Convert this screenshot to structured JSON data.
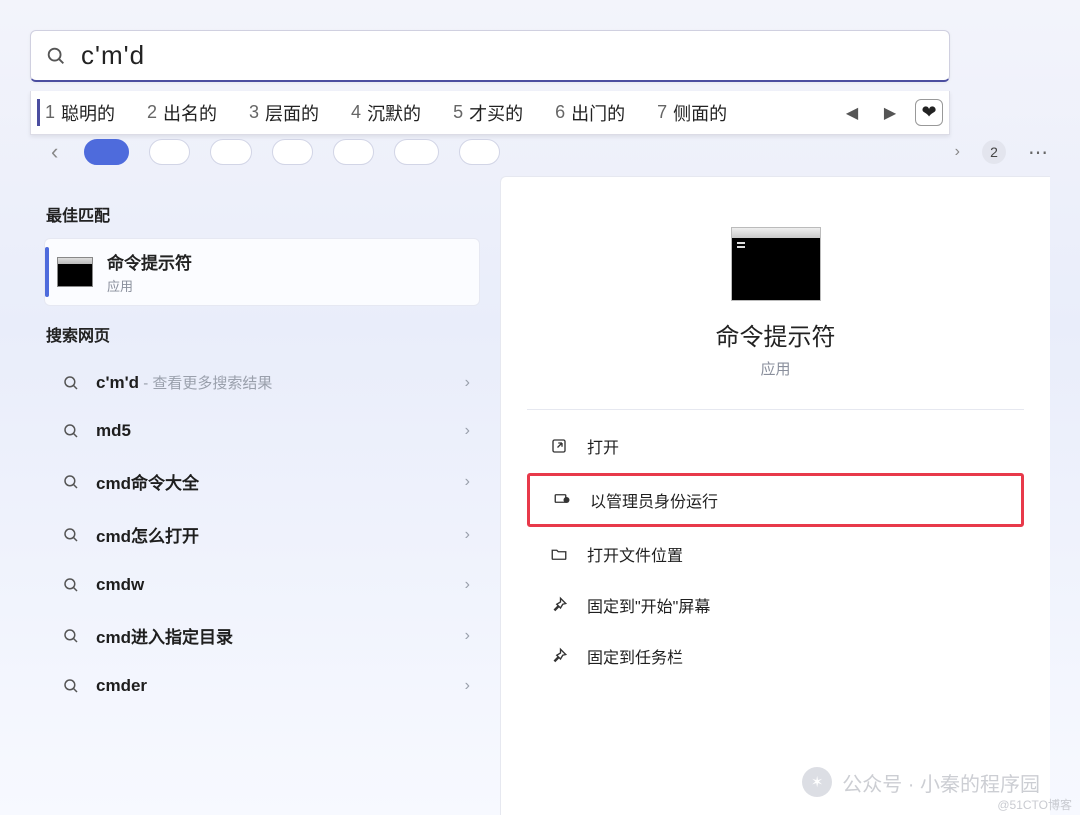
{
  "search": {
    "value": "c'm'd"
  },
  "ime": {
    "candidates": [
      {
        "n": "1",
        "w": "聪明的"
      },
      {
        "n": "2",
        "w": "出名的"
      },
      {
        "n": "3",
        "w": "层面的"
      },
      {
        "n": "4",
        "w": "沉默的"
      },
      {
        "n": "5",
        "w": "才买的"
      },
      {
        "n": "6",
        "w": "出门的"
      },
      {
        "n": "7",
        "w": "侧面的"
      }
    ]
  },
  "badge_count": "2",
  "left": {
    "best_label": "最佳匹配",
    "best_title": "命令提示符",
    "best_sub": "应用",
    "web_label": "搜索网页",
    "web": [
      {
        "q": "c'm'd",
        "hint": " - 查看更多搜索结果"
      },
      {
        "q": "md5",
        "hint": ""
      },
      {
        "q": "cmd命令大全",
        "hint": ""
      },
      {
        "q": "cmd怎么打开",
        "hint": ""
      },
      {
        "q": "cmdw",
        "hint": ""
      },
      {
        "q": "cmd进入指定目录",
        "hint": ""
      },
      {
        "q": "cmder",
        "hint": ""
      }
    ]
  },
  "right": {
    "title": "命令提示符",
    "sub": "应用",
    "actions": {
      "open": "打开",
      "admin": "以管理员身份运行",
      "loc": "打开文件位置",
      "pin_start": "固定到\"开始\"屏幕",
      "pin_task": "固定到任务栏"
    }
  },
  "watermark": "公众号 · 小秦的程序园",
  "footer_mark": "@51CTO博客"
}
